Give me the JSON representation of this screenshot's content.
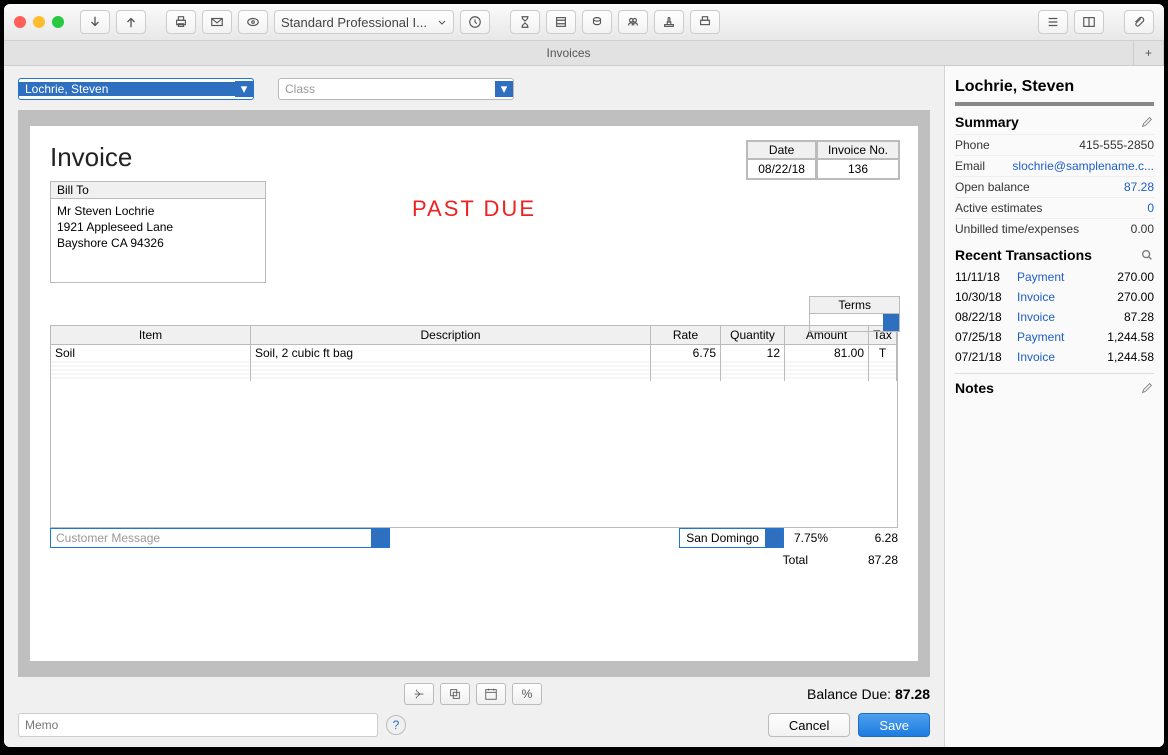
{
  "toolbar": {
    "template_label": "Standard Professional I..."
  },
  "tab": {
    "title": "Invoices"
  },
  "selectors": {
    "customer": "Lochrie, Steven",
    "class_placeholder": "Class"
  },
  "invoice": {
    "title": "Invoice",
    "date_label": "Date",
    "date_value": "08/22/18",
    "invno_label": "Invoice No.",
    "invno_value": "136",
    "billto_label": "Bill To",
    "billto_line1": "Mr Steven Lochrie",
    "billto_line2": "1921 Appleseed Lane",
    "billto_line3": "Bayshore CA 94326",
    "stamp": "PAST DUE",
    "terms_label": "Terms",
    "columns": {
      "item": "Item",
      "desc": "Description",
      "rate": "Rate",
      "qty": "Quantity",
      "amt": "Amount",
      "tax": "Tax"
    },
    "line1": {
      "item": "Soil",
      "desc": "Soil, 2 cubic ft bag",
      "rate": "6.75",
      "qty": "12",
      "amt": "81.00",
      "tax": "T"
    },
    "cust_msg_placeholder": "Customer Message",
    "tax_name": "San Domingo",
    "tax_pct": "7.75%",
    "tax_amt": "6.28",
    "total_label": "Total",
    "total_value": "87.28",
    "balance_label": "Balance Due:",
    "balance_value": "87.28",
    "memo_placeholder": "Memo",
    "cancel": "Cancel",
    "save": "Save",
    "percent": "%"
  },
  "right": {
    "name": "Lochrie, Steven",
    "summary_label": "Summary",
    "phone_k": "Phone",
    "phone_v": "415-555-2850",
    "email_k": "Email",
    "email_v": "slochrie@samplename.c...",
    "openbal_k": "Open balance",
    "openbal_v": "87.28",
    "active_k": "Active estimates",
    "active_v": "0",
    "unbilled_k": "Unbilled time/expenses",
    "unbilled_v": "0.00",
    "recent_label": "Recent Transactions",
    "r1": {
      "d": "11/11/18",
      "t": "Payment",
      "a": "270.00"
    },
    "r2": {
      "d": "10/30/18",
      "t": "Invoice",
      "a": "270.00"
    },
    "r3": {
      "d": "08/22/18",
      "t": "Invoice",
      "a": "87.28"
    },
    "r4": {
      "d": "07/25/18",
      "t": "Payment",
      "a": "1,244.58"
    },
    "r5": {
      "d": "07/21/18",
      "t": "Invoice",
      "a": "1,244.58"
    },
    "notes_label": "Notes"
  }
}
